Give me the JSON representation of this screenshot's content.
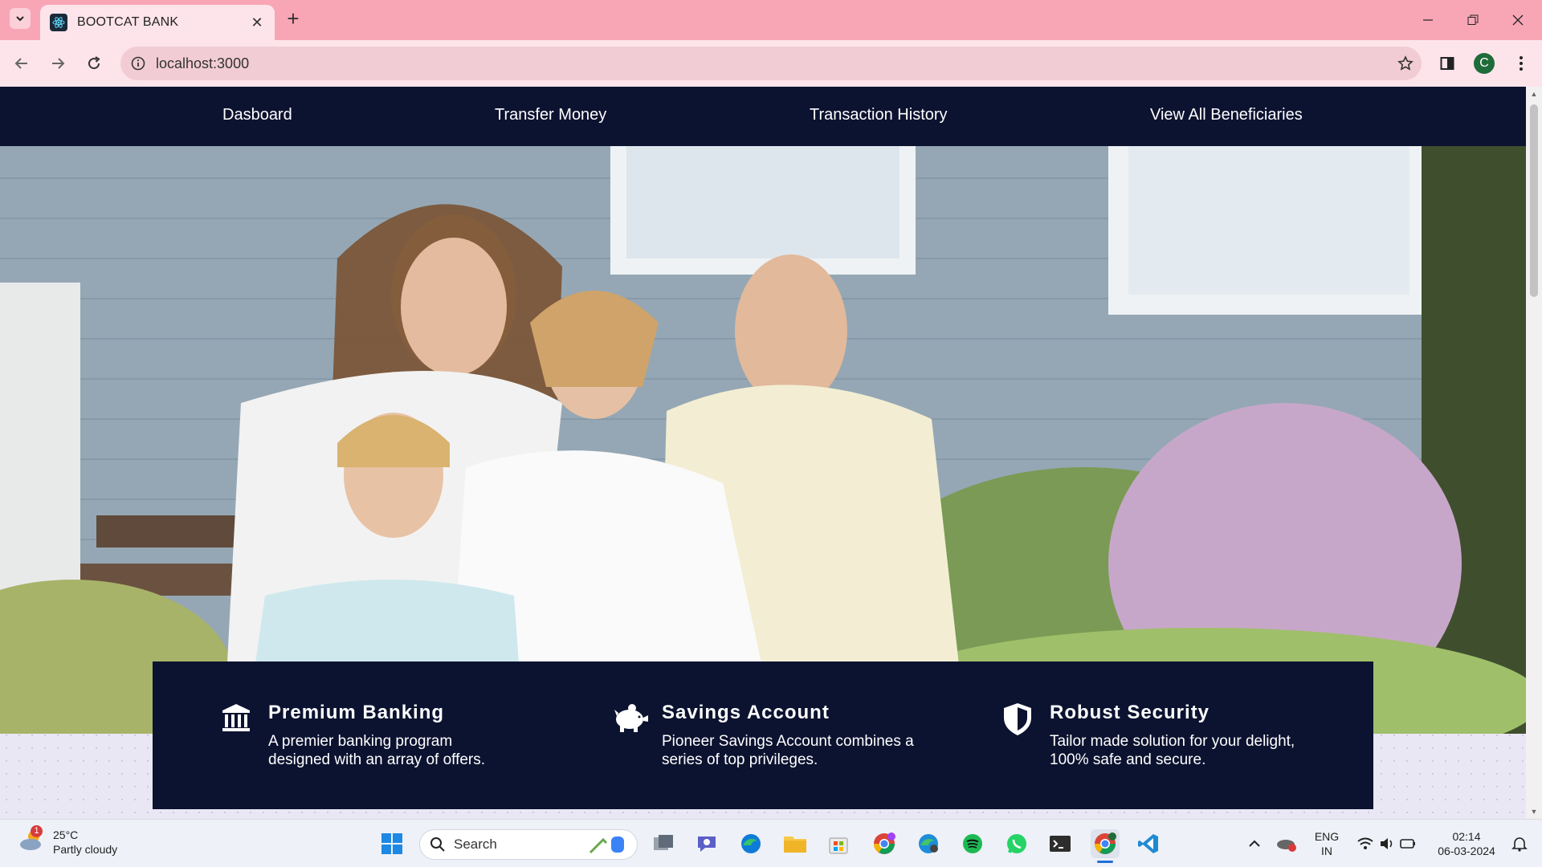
{
  "browser": {
    "tab_title": "BOOTCAT BANK",
    "url": "localhost:3000",
    "profile_initial": "C"
  },
  "site": {
    "nav": [
      {
        "label": "Dasboard"
      },
      {
        "label": "Transfer Money"
      },
      {
        "label": "Transaction History"
      },
      {
        "label": "View All Beneficiaries"
      }
    ],
    "features": [
      {
        "icon": "bank-icon",
        "title": "Premium Banking",
        "desc": "A premier banking program designed with an array of offers."
      },
      {
        "icon": "piggy-bank-icon",
        "title": "Savings Account",
        "desc": "Pioneer Savings Account combines a series of top privileges."
      },
      {
        "icon": "shield-icon",
        "title": "Robust Security",
        "desc": "Tailor made solution for your delight, 100% safe and secure."
      }
    ]
  },
  "taskbar": {
    "weather_temp": "25°C",
    "weather_desc": "Partly cloudy",
    "weather_badge": "1",
    "search_label": "Search",
    "lang_line1": "ENG",
    "lang_line2": "IN",
    "time": "02:14",
    "date": "06-03-2024"
  },
  "colors": {
    "tabstrip": "#f8a6b6",
    "navbar": "#0c1330",
    "features_bg": "#0c1330"
  }
}
